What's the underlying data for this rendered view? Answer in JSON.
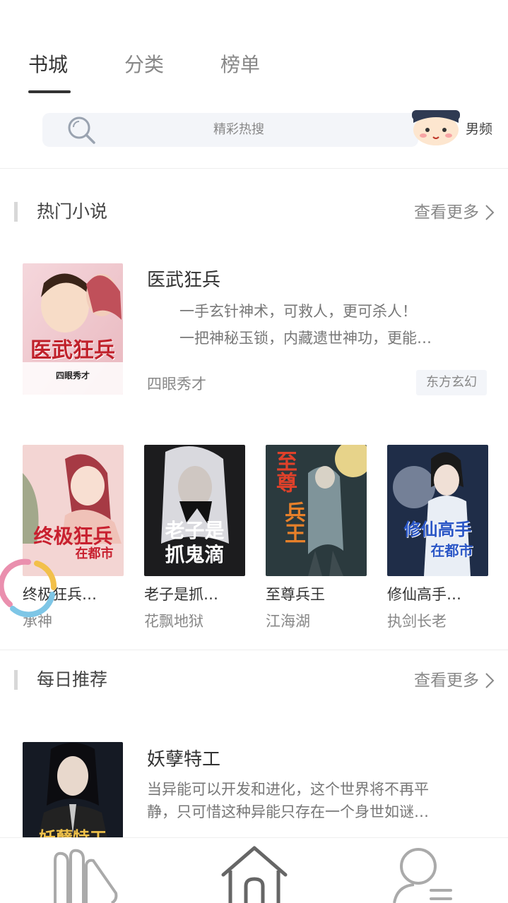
{
  "tabs": [
    {
      "label": "书城",
      "active": true
    },
    {
      "label": "分类",
      "active": false
    },
    {
      "label": "榜单",
      "active": false
    }
  ],
  "search": {
    "placeholder": "精彩热搜",
    "icon": "search-icon"
  },
  "gender": {
    "label": "男频",
    "icon": "boy-avatar-icon"
  },
  "hot_section": {
    "title": "热门小说",
    "more": "查看更多"
  },
  "featured": {
    "title": "医武狂兵",
    "desc_lines": [
      "一手玄针神术，可救人，更可杀人！",
      "一把神秘玉锁，内藏遗世神功，更能…"
    ],
    "author": "四眼秀才",
    "tag": "东方玄幻",
    "cover_text": "医武狂兵",
    "cover_sub": "四眼秀才"
  },
  "grid_books": [
    {
      "title": "终极狂兵…",
      "author": "承神",
      "cover_text": "终极狂兵",
      "cover_sub": "在都市"
    },
    {
      "title": "老子是抓…",
      "author": "花飘地狱",
      "cover_text": "老子是",
      "cover_sub": "抓鬼滴"
    },
    {
      "title": "至尊兵王",
      "author": "江海湖",
      "cover_text": "至尊",
      "cover_sub": "兵王"
    },
    {
      "title": "修仙高手…",
      "author": "执剑长老",
      "cover_text": "修仙高手",
      "cover_sub": "在都市"
    }
  ],
  "daily_section": {
    "title": "每日推荐",
    "more": "查看更多"
  },
  "daily": {
    "title": "妖孽特工",
    "desc_lines": [
      "当异能可以开发和进化，这个世界将不再平",
      "静，只可惜这种异能只存在一个身世如谜…"
    ],
    "cover_text": "妖孽特工"
  },
  "bottom_nav": [
    {
      "name": "nav-bookshelf",
      "icon": "bookshelf-icon"
    },
    {
      "name": "nav-home",
      "icon": "home-icon"
    },
    {
      "name": "nav-profile",
      "icon": "profile-icon"
    }
  ],
  "colors": {
    "accent": "#333333",
    "muted": "#888888",
    "search_bg": "#f3f5f9",
    "nav_icon": "#999999"
  }
}
